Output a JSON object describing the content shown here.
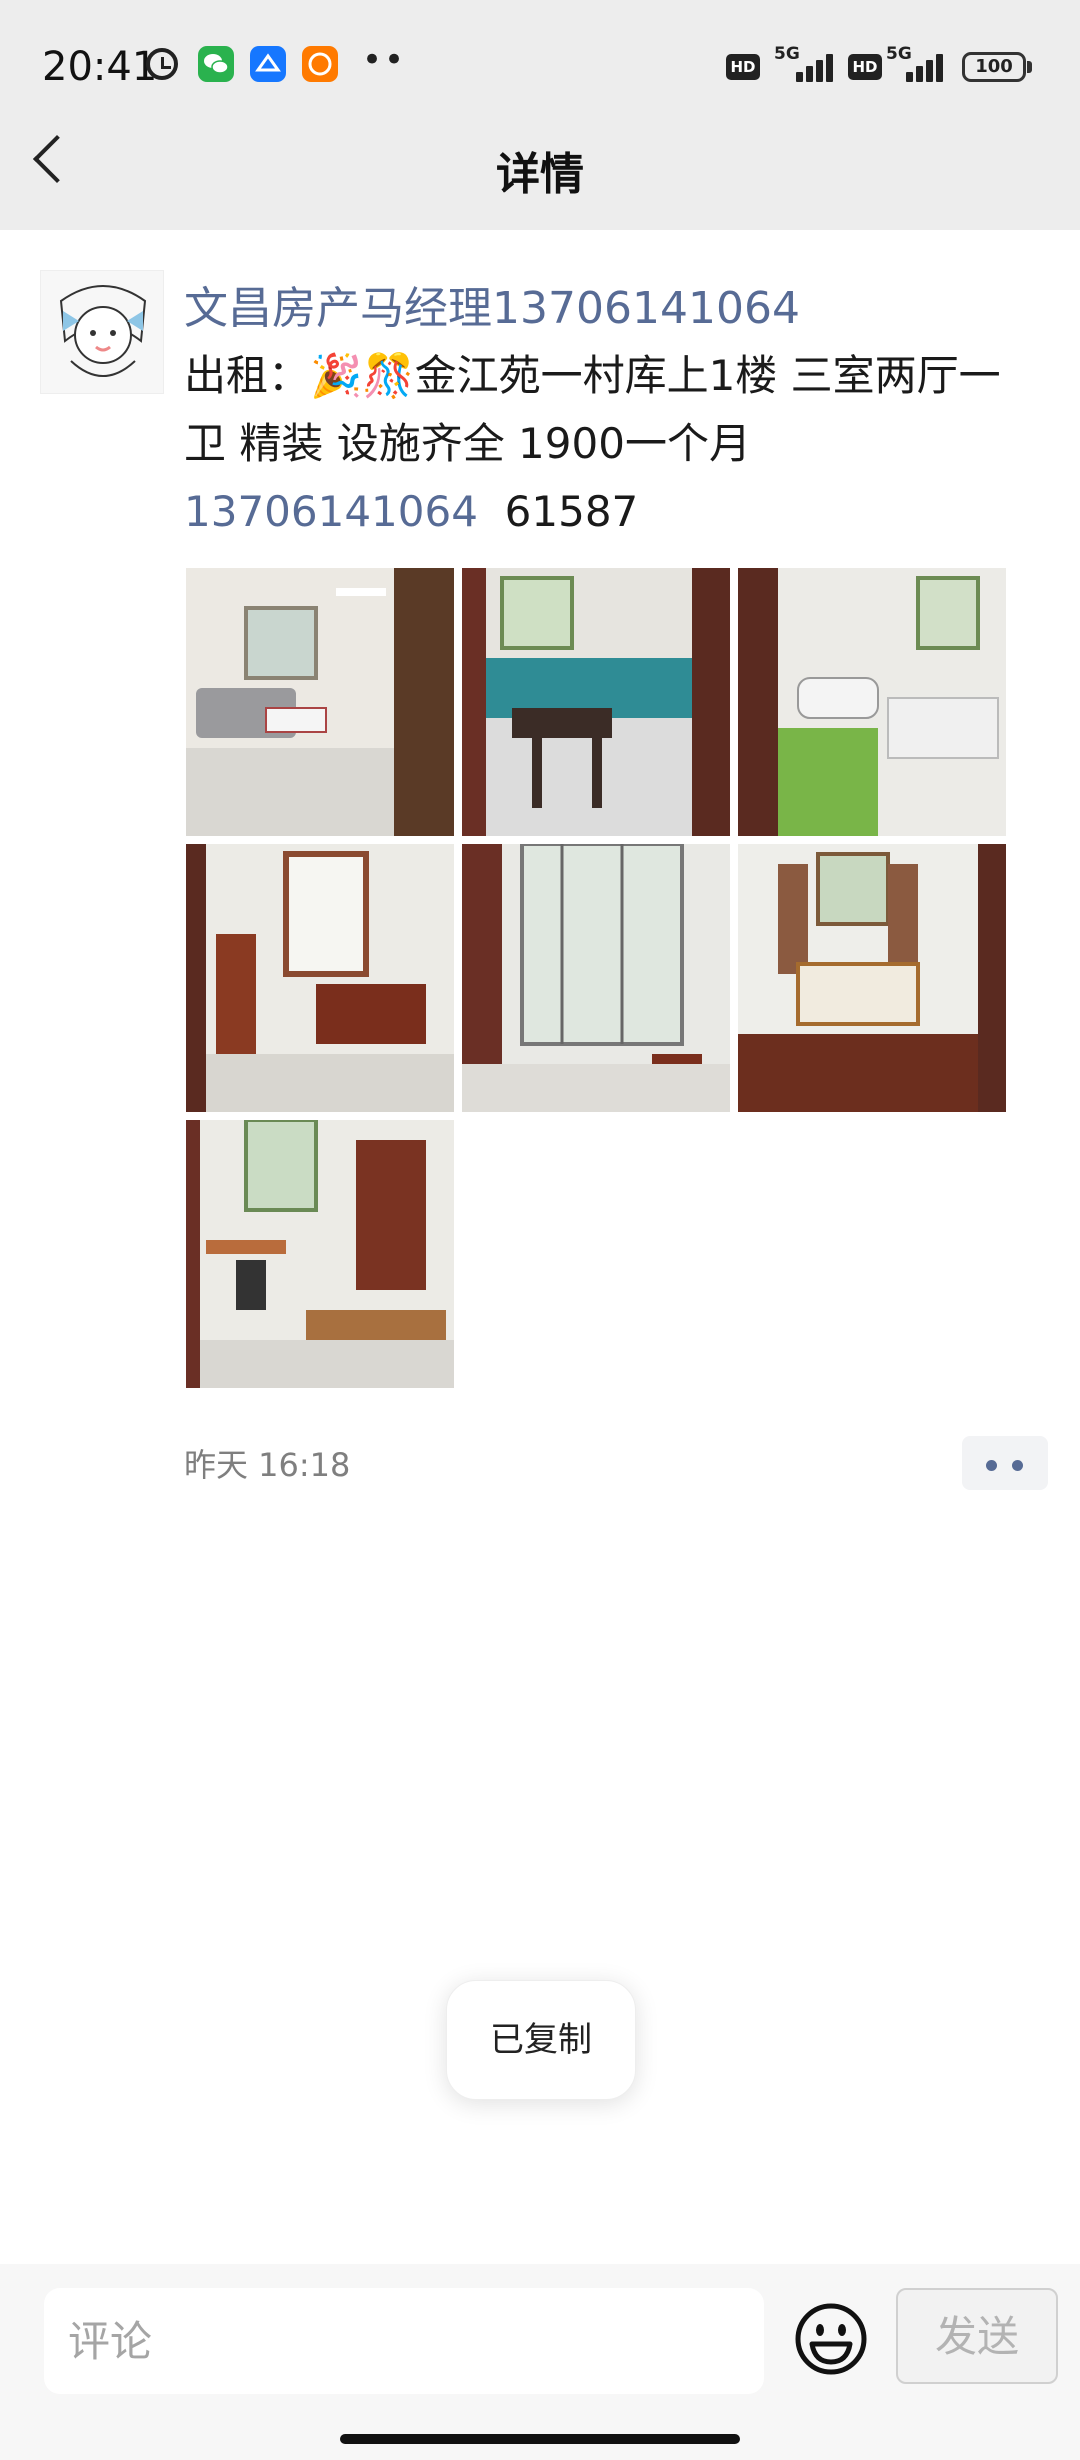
{
  "status_bar": {
    "time": "20:41",
    "signal_label_1": "HD",
    "net_label_1": "5G",
    "signal_label_2": "HD",
    "net_label_2": "5G",
    "battery": "100",
    "notification_icons": [
      "wechat-icon",
      "alipay-icon",
      "taobao-icon"
    ]
  },
  "header": {
    "title": "详情"
  },
  "post": {
    "author": "文昌房产马经理13706141064",
    "text_prefix": "出租：🎉🎊金江苑一村库上1楼  三室两厅一卫  精装  设施齐全  1900一个月",
    "phone": "13706141064",
    "text_suffix": "61587",
    "photos": [
      "living-room",
      "kitchen",
      "bathroom",
      "bedroom",
      "balcony",
      "bedroom-2",
      "study-room"
    ],
    "timestamp": "昨天 16:18"
  },
  "toast": {
    "text": "已复制"
  },
  "comment_bar": {
    "placeholder": "评论",
    "send_label": "发送"
  },
  "colors": {
    "link": "#576b95",
    "header_bg": "#ededed"
  }
}
